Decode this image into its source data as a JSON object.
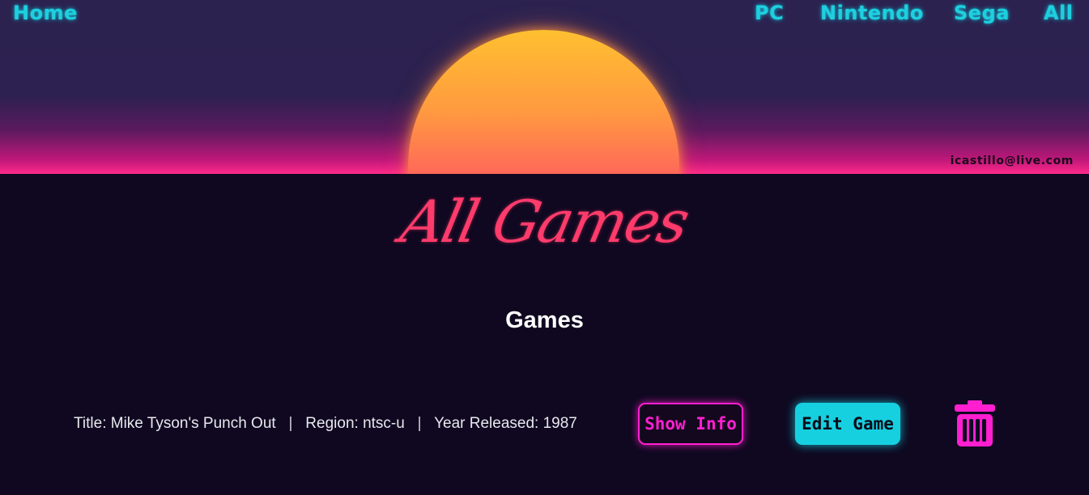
{
  "nav": {
    "home": "Home",
    "pc": "PC",
    "nintendo": "Nintendo",
    "sega": "Sega",
    "all": "All"
  },
  "user": {
    "email": "icastillo@live.com"
  },
  "page": {
    "title": "All Games",
    "section_title": "Games"
  },
  "games": [
    {
      "title_label": "Title: Mike Tyson's Punch Out",
      "region_label": "Region: ntsc-u",
      "year_label": "Year Released: 1987",
      "separator": "|",
      "show_info_label": "Show Info",
      "edit_label": "Edit Game",
      "delete_icon": "trash-icon"
    }
  ],
  "colors": {
    "nav_cyan": "#1ecfe0",
    "title_pink": "#ff3b6b",
    "magenta": "#ff1fd0",
    "background": "#0f0820"
  }
}
